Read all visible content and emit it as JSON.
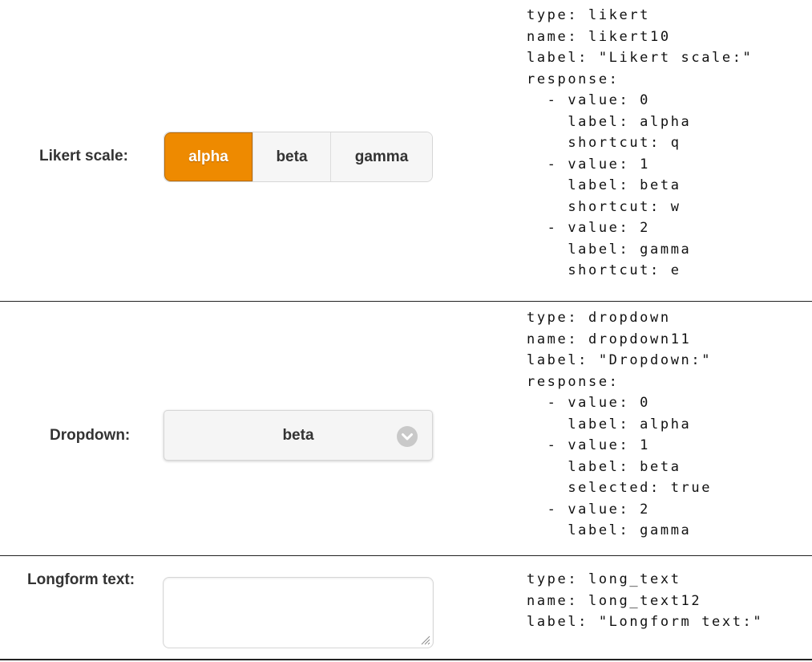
{
  "likert": {
    "label": "Likert scale:",
    "options": [
      {
        "label": "alpha",
        "selected": true
      },
      {
        "label": "beta",
        "selected": false
      },
      {
        "label": "gamma",
        "selected": false
      }
    ],
    "accent_color": "#ee8a00",
    "code_lines": [
      "type: likert",
      "name: likert10",
      "label: \"Likert scale:\"",
      "response:",
      "  - value: 0",
      "    label: alpha",
      "    shortcut: q",
      "  - value: 1",
      "    label: beta",
      "    shortcut: w",
      "  - value: 2",
      "    label: gamma",
      "    shortcut: e"
    ]
  },
  "dropdown": {
    "label": "Dropdown:",
    "selected_value": "beta",
    "icon": "chevron-down-circle-icon",
    "code_lines": [
      "type: dropdown",
      "name: dropdown11",
      "label: \"Dropdown:\"",
      "response:",
      "  - value: 0",
      "    label: alpha",
      "  - value: 1",
      "    label: beta",
      "    selected: true",
      "  - value: 2",
      "    label: gamma"
    ]
  },
  "longform": {
    "label": "Longform text:",
    "value": "",
    "icon": "resize-handle-icon",
    "code_lines": [
      "type: long_text",
      "name: long_text12",
      "label: \"Longform text:\""
    ]
  }
}
